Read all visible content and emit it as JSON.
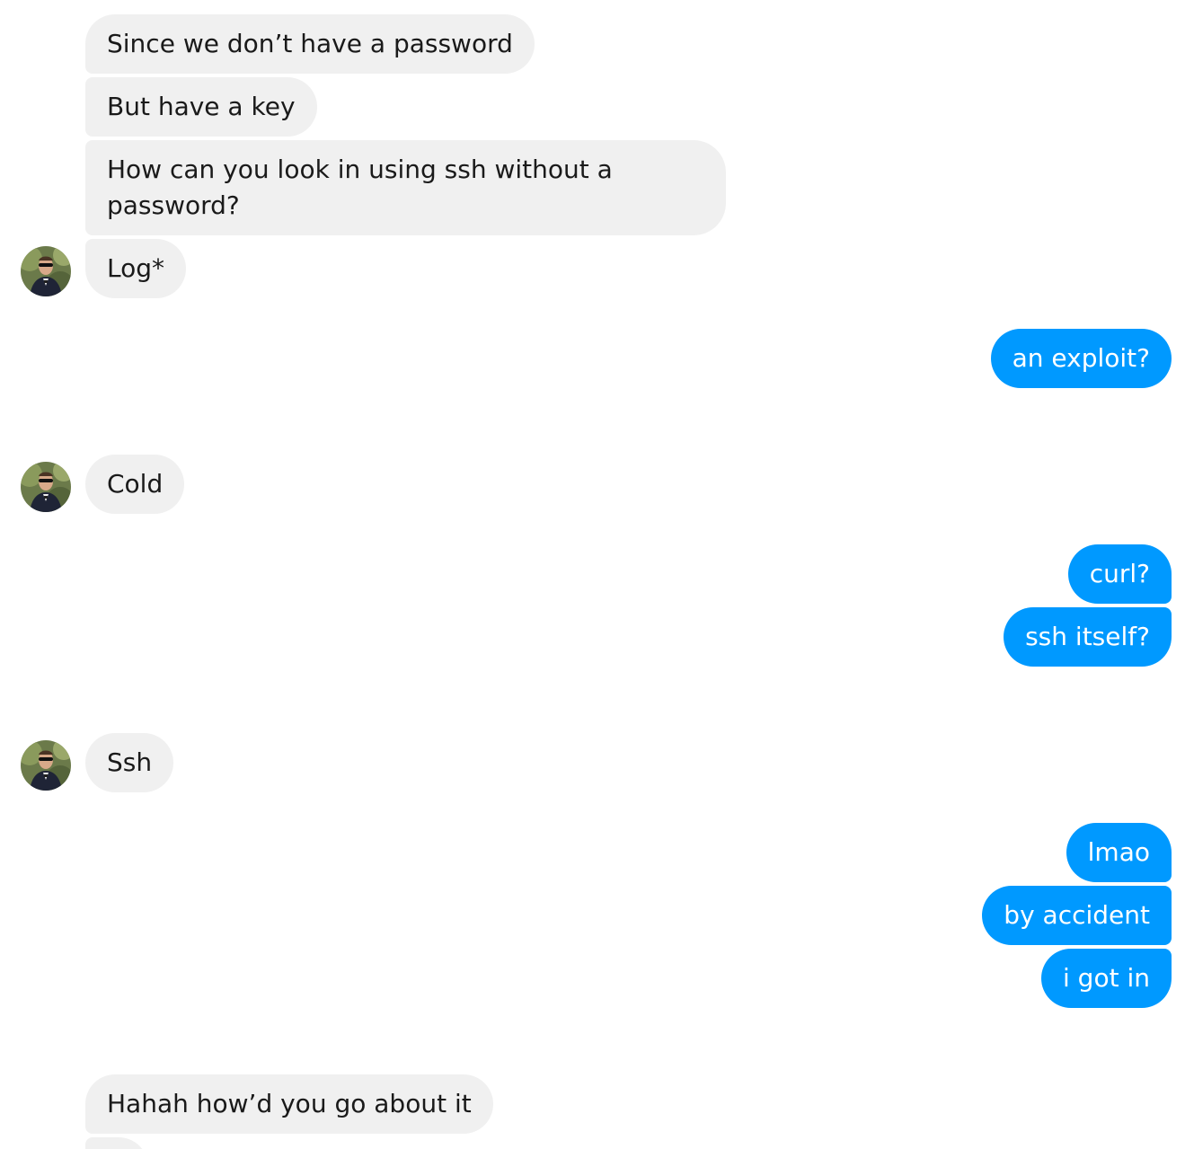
{
  "incoming_group_1": {
    "messages": [
      "Since we don’t have a password",
      "But have a key",
      "How can you look in using ssh without a password?",
      "Log*"
    ]
  },
  "outgoing_group_1": {
    "messages": [
      "an exploit?"
    ]
  },
  "incoming_group_2": {
    "messages": [
      "Cold"
    ]
  },
  "outgoing_group_2": {
    "messages": [
      "curl?",
      "ssh itself?"
    ]
  },
  "incoming_group_3": {
    "messages": [
      "Ssh"
    ]
  },
  "outgoing_group_3": {
    "messages": [
      "lmao",
      "by accident",
      "i got in"
    ]
  },
  "incoming_group_4": {
    "messages": [
      "Hahah how’d you go about it"
    ]
  },
  "colors": {
    "incoming_bubble": "#f0f0f0",
    "outgoing_bubble": "#0099ff",
    "outgoing_text": "#ffffff",
    "incoming_text": "#1a1a1a"
  },
  "icons": {
    "avatar": "contact-avatar-photo"
  }
}
